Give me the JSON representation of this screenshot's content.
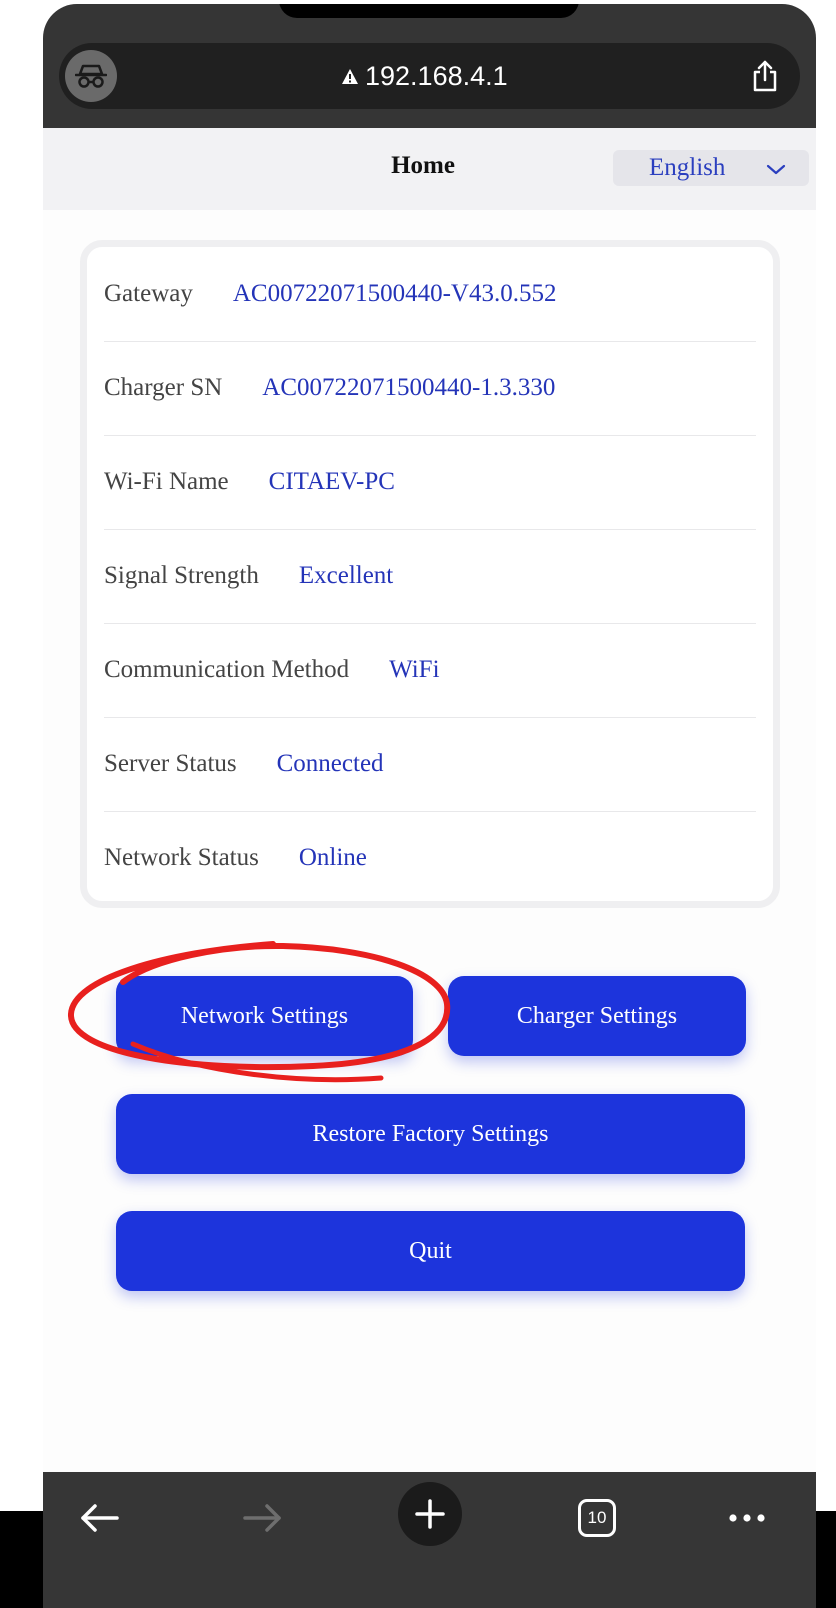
{
  "browser": {
    "url": "192.168.4.1",
    "tab_count": "10"
  },
  "header": {
    "title": "Home",
    "language": "English"
  },
  "info_rows": [
    {
      "label": "Gateway",
      "value": "AC00722071500440-V43.0.552"
    },
    {
      "label": "Charger SN",
      "value": "AC00722071500440-1.3.330"
    },
    {
      "label": "Wi-Fi Name",
      "value": "CITAEV-PC"
    },
    {
      "label": "Signal Strength",
      "value": "Excellent"
    },
    {
      "label": "Communication Method",
      "value": "WiFi"
    },
    {
      "label": "Server Status",
      "value": "Connected"
    },
    {
      "label": "Network Status",
      "value": "Online"
    }
  ],
  "buttons": {
    "network_settings": "Network Settings",
    "charger_settings": "Charger Settings",
    "restore_factory": "Restore Factory Settings",
    "quit": "Quit"
  },
  "colors": {
    "accent": "#1d34dc",
    "value_text": "#2434b8",
    "annotation": "#e8201e",
    "browser_chrome": "#353535"
  },
  "icons": {
    "incognito": "incognito-icon",
    "warning": "warning-icon",
    "share": "share-icon",
    "chevron": "chevron-down-icon",
    "back": "back-arrow-icon",
    "forward": "forward-arrow-icon",
    "new_tab": "plus-icon",
    "tabs": "tabs-icon",
    "more": "more-icon"
  }
}
